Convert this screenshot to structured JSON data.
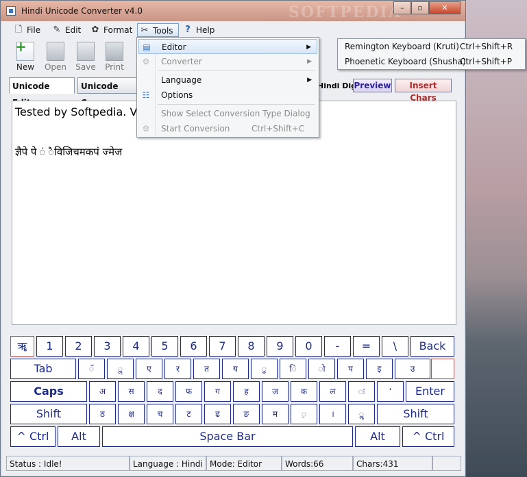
{
  "window": {
    "title": "Hindi Unicode Converter v4.0",
    "watermark": "SOFTPEDIA"
  },
  "menubar": {
    "file": "File",
    "edit": "Edit",
    "format": "Format",
    "tools": "Tools",
    "help": "Help"
  },
  "toolbar": {
    "new": "New",
    "open": "Open",
    "save": "Save",
    "print": "Print"
  },
  "tabs": {
    "unicode_editor": "Unicode Editor",
    "unicode_converter": "Unicode Conve",
    "hindi_digit": "Hindi Digit",
    "preview": "Preview",
    "insert_chars": "Insert Chars"
  },
  "editor": {
    "line1": "Tested by Softpedia. Vis",
    "line2": "ज्ञैपे पे ं ैविजिचमकपं ज्मेज"
  },
  "tools_menu": {
    "editor": "Editor",
    "converter": "Converter",
    "language": "Language",
    "options": "Options",
    "show_dialog": "Show Select Conversion Type Dialog",
    "start_conversion": "Start Conversion",
    "start_conversion_shortcut": "Ctrl+Shift+C"
  },
  "editor_submenu": {
    "remington": "Remington Keyboard (Kruti)",
    "remington_shortcut": "Ctrl+Shift+R",
    "phoenetic": "Phoenetic Keyboard (Shusha)",
    "phoenetic_shortcut": "Ctrl+Shift+P"
  },
  "keyboard": {
    "row1": [
      "ॠ",
      "1",
      "2",
      "3",
      "4",
      "5",
      "6",
      "7",
      "8",
      "9",
      "0",
      "-",
      "=",
      "\\",
      "Back"
    ],
    "row2": [
      "Tab",
      "ॅ",
      "ॢ",
      "ए",
      "र",
      "त",
      "य",
      "ु",
      "ि",
      "ो",
      "प",
      "इ",
      "उ",
      ""
    ],
    "row3": [
      "Caps",
      "अ",
      "स",
      "द",
      "फ",
      "ग",
      "ह",
      "ज",
      "क",
      "ल",
      "ः",
      "‘",
      "Enter"
    ],
    "row4": [
      "Shift",
      "ठ",
      "क्ष",
      "च",
      "ट",
      "ढ",
      "ङ",
      "म",
      "़",
      "।",
      "ॣ",
      "Shift"
    ],
    "row5": [
      "^ Ctrl",
      "Alt",
      "Space Bar",
      "Alt",
      "^ Ctrl"
    ]
  },
  "statusbar": {
    "status": "Status : Idle!",
    "language": "Language : Hindi",
    "mode": "Mode: Editor",
    "words": "Words:66",
    "chars": "Chars:431"
  }
}
